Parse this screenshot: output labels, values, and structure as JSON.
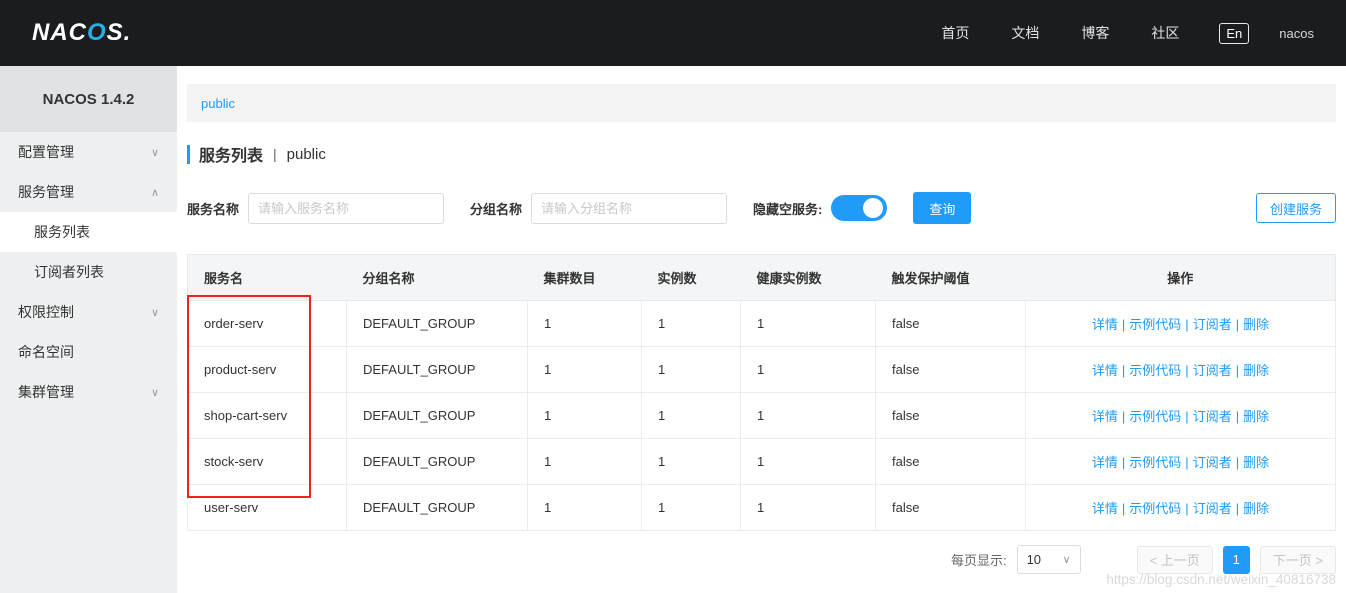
{
  "colors": {
    "accent": "#209bfa",
    "topbar_bg": "#1b1c1e",
    "annotation": "#ee2222",
    "logo_cyan": "#25b1e8"
  },
  "topbar": {
    "logo_part1": "NAC",
    "logo_part2": "O",
    "logo_part3": "S.",
    "nav": [
      "首页",
      "文档",
      "博客",
      "社区"
    ],
    "lang": "En",
    "user": "nacos"
  },
  "sidebar": {
    "version": "NACOS 1.4.2",
    "items": [
      {
        "label": "配置管理",
        "chevron": "down",
        "child": false,
        "active": false
      },
      {
        "label": "服务管理",
        "chevron": "up",
        "child": false,
        "active": false
      },
      {
        "label": "服务列表",
        "chevron": "",
        "child": true,
        "active": true
      },
      {
        "label": "订阅者列表",
        "chevron": "",
        "child": true,
        "active": false
      },
      {
        "label": "权限控制",
        "chevron": "down",
        "child": false,
        "active": false
      },
      {
        "label": "命名空间",
        "chevron": "",
        "child": false,
        "active": false
      },
      {
        "label": "集群管理",
        "chevron": "down",
        "child": false,
        "active": false
      }
    ]
  },
  "breadcrumb": "public",
  "page": {
    "title": "服务列表",
    "separator": "|",
    "subtitle": "public"
  },
  "filters": {
    "service_name_label": "服务名称",
    "service_name_placeholder": "请输入服务名称",
    "group_name_label": "分组名称",
    "group_name_placeholder": "请输入分组名称",
    "hide_empty_label": "隐藏空服务:",
    "search_button": "查询",
    "create_button": "创建服务"
  },
  "table": {
    "columns": [
      "服务名",
      "分组名称",
      "集群数目",
      "实例数",
      "健康实例数",
      "触发保护阈值",
      "操作"
    ],
    "action_labels": [
      "详情",
      "示例代码",
      "订阅者",
      "删除"
    ],
    "rows": [
      {
        "name": "order-serv",
        "group": "DEFAULT_GROUP",
        "clusters": "1",
        "instances": "1",
        "healthy": "1",
        "threshold": "false"
      },
      {
        "name": "product-serv",
        "group": "DEFAULT_GROUP",
        "clusters": "1",
        "instances": "1",
        "healthy": "1",
        "threshold": "false"
      },
      {
        "name": "shop-cart-serv",
        "group": "DEFAULT_GROUP",
        "clusters": "1",
        "instances": "1",
        "healthy": "1",
        "threshold": "false"
      },
      {
        "name": "stock-serv",
        "group": "DEFAULT_GROUP",
        "clusters": "1",
        "instances": "1",
        "healthy": "1",
        "threshold": "false"
      },
      {
        "name": "user-serv",
        "group": "DEFAULT_GROUP",
        "clusters": "1",
        "instances": "1",
        "healthy": "1",
        "threshold": "false"
      }
    ]
  },
  "pagination": {
    "per_page_label": "每页显示:",
    "per_page_value": "10",
    "prev_label": "< 上一页",
    "current_page": "1",
    "next_label": "下一页 >"
  },
  "watermark": "https://blog.csdn.net/weixin_40816738"
}
